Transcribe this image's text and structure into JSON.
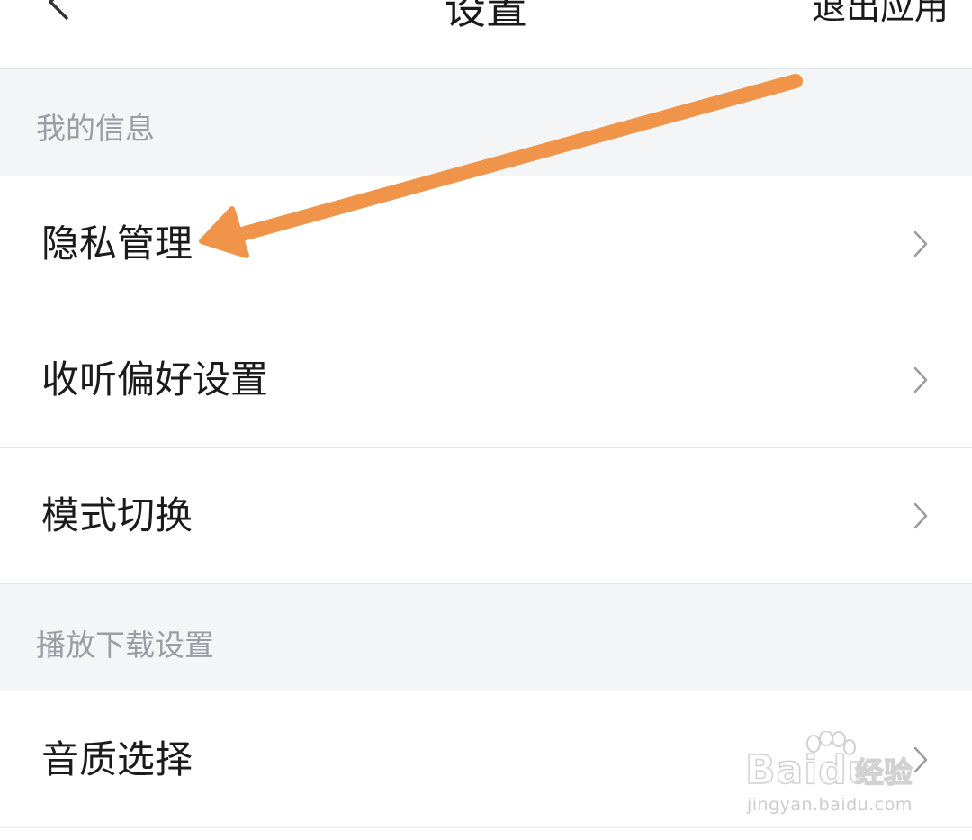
{
  "header": {
    "title": "设置",
    "action_label": "退出应用"
  },
  "sections": [
    {
      "title": "我的信息",
      "items": [
        {
          "label": "隐私管理"
        },
        {
          "label": "收听偏好设置"
        },
        {
          "label": "模式切换"
        }
      ]
    },
    {
      "title": "播放下载设置",
      "items": [
        {
          "label": "音质选择"
        }
      ]
    }
  ],
  "annotation": {
    "arrow_color": "#f0944a"
  },
  "watermark": {
    "brand": "Baidu",
    "product": "经验",
    "url": "jingyan.baidu.com"
  },
  "icons": {
    "back": "chevron-left-icon",
    "row_chevron": "chevron-right-icon"
  }
}
